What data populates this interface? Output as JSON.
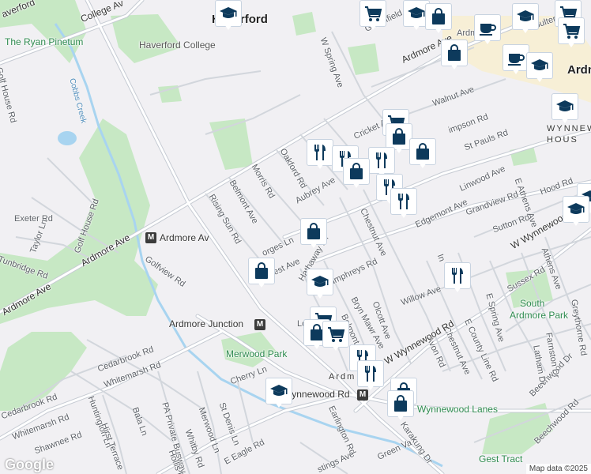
{
  "map": {
    "attribution": "Map data ©2025",
    "logo": "Google",
    "colors": {
      "background": "#f1f0f3",
      "park": "#c7e8c4",
      "road": "#ffffff",
      "road_border": "#c6cbd3",
      "major_road": "#ffffff",
      "water": "#a8d4f0",
      "commercial": "#f7efd6",
      "pin_icon": "#0d3a5c"
    }
  },
  "places": {
    "haverford_college": "Haverford College",
    "haverford": "Haverford",
    "ryan_pinetum": "The Ryan Pinetum",
    "merwood_park": "Merwood Park",
    "south_ardmore_park": "South Ardmore Park",
    "gest_tract": "Gest Tract",
    "wynnewood_lanes": "Wynnewood Lanes",
    "wynnewood_house": "WYNNEWOOD HOUSE",
    "ardmore_top": "Ardmore",
    "ardmore_park": "ARDMORE PARK",
    "cobbs_creek": "Cobbs Creek"
  },
  "stations": {
    "ardmore_av": "Ardmore Av",
    "ardmore_junction": "Ardmore Junction",
    "wynnewood_rd": "Wynnewood Rd"
  },
  "streets": {
    "college_av": "College Av",
    "haverford_rd": "averford",
    "golf_house_rd_top": "Golf House Rd",
    "exeter_rd": "Exeter Rd",
    "tunbridge_rd": "Tunbridge Rd",
    "taylor_ln": "Taylor Ln",
    "golf_house_rd": "Golf House Rd",
    "ardmore_ave_left": "Ardmore Ave",
    "ardmore_ave_mid": "Ardmore Ave",
    "ardmore_ave_top": "Ardmore Ave",
    "golfview_rd": "Golfview Rd",
    "cedarbrook_rd": "Cedarbrook Rd",
    "cedarbrook_rd_2": "Cedarbrook Rd",
    "whitemarsh_rd": "Whitemarsh Rd",
    "whitemarsh_rd_2": "Whitemarsh Rd",
    "shawnee_rd": "Shawnee Rd",
    "huntington_ln": "Huntington Ln",
    "bala_ln": "Bala Ln",
    "hirst_terrace": "Hirst Terrace",
    "pa_busway": "PA Private Busway",
    "hollis_rd": "Hollis Rd",
    "whitby_rd": "Whitby Rd",
    "merwood_ln": "Merwood Ln",
    "st_denis_ln": "St Denis Ln",
    "e_eagle_rd": "E Eagle Rd",
    "cherry_ln": "Cherry Ln",
    "earlington_rd": "Earlington Rd",
    "hastings_ave": "stings Ave",
    "green_valley": "Green Va",
    "karakung_dr": "Karakung Dr",
    "beechwood_rd": "Beechwood Rd",
    "beechwood_dr": "Beechwood Dr",
    "farnston_dr": "Farnston Dr",
    "latham_dr": "Latham Dr",
    "greythorne_rd": "Greythorne Rd",
    "sussex_rd": "Sussex Rd",
    "e_spring_ave": "E Spring Ave",
    "e_county_line_rd": "E County Line Rd",
    "chestnut_ave_low": "Chestnut Ave",
    "avon_rd": "Avon Rd",
    "w_wynnewood_rd": "W Wynnewood Rd",
    "w_wynnewood_rd_2": "W Wynnewood R",
    "willow_ave": "Willow Ave",
    "olcott_ave": "Olcott Ave",
    "bryn_mawr_ave": "Bryn Mawr Ave",
    "belmont_low": "Belmont",
    "humphreys_rd": "Humphreys Rd",
    "hathaway_ln": "Hathaway Ln",
    "forest_ave": "est Ave",
    "georges_ln": "orges Ln",
    "rising_sun_rd": "Rising Sun Rd",
    "belmont_ave": "Belmont Ave",
    "morris_rd": "Morris Rd",
    "oakford_rd": "Oakford Rd",
    "aubrey_ave": "Aubrey Ave",
    "chestnut_ave": "Chestnut Ave",
    "edgemont_ave": "Edgemont Ave",
    "grandview_rd": "Grandview Rd",
    "sutton_rd": "Sutton Rd",
    "linwood_ave": "Linwood Ave",
    "st_pauls_rd": "St Pauls Rd",
    "simpson_rd": "impson Rd",
    "walnut_ave": "Walnut Ave",
    "cricket_ave": "Cricket A",
    "w_spring_ave": "W Spring Ave",
    "greenfield_ave": "Greenfield Ave",
    "coulter_ave": "Coulter Ave",
    "e_athens_ave": "E Athens Ave",
    "athens_ave": "Athens Ave",
    "hood_rd": "Hood Rd",
    "lo": "Lo",
    "in_": "In",
    "ardm": "Ardm",
    "ardmore_avt": "Ardmore",
    "w_wynnewood_top": "W Wynnewood R"
  },
  "pins": [
    {
      "icon": "graduation-cap-icon"
    },
    {
      "icon": "shopping-bag-icon"
    },
    {
      "icon": "shopping-cart-icon"
    }
  ]
}
